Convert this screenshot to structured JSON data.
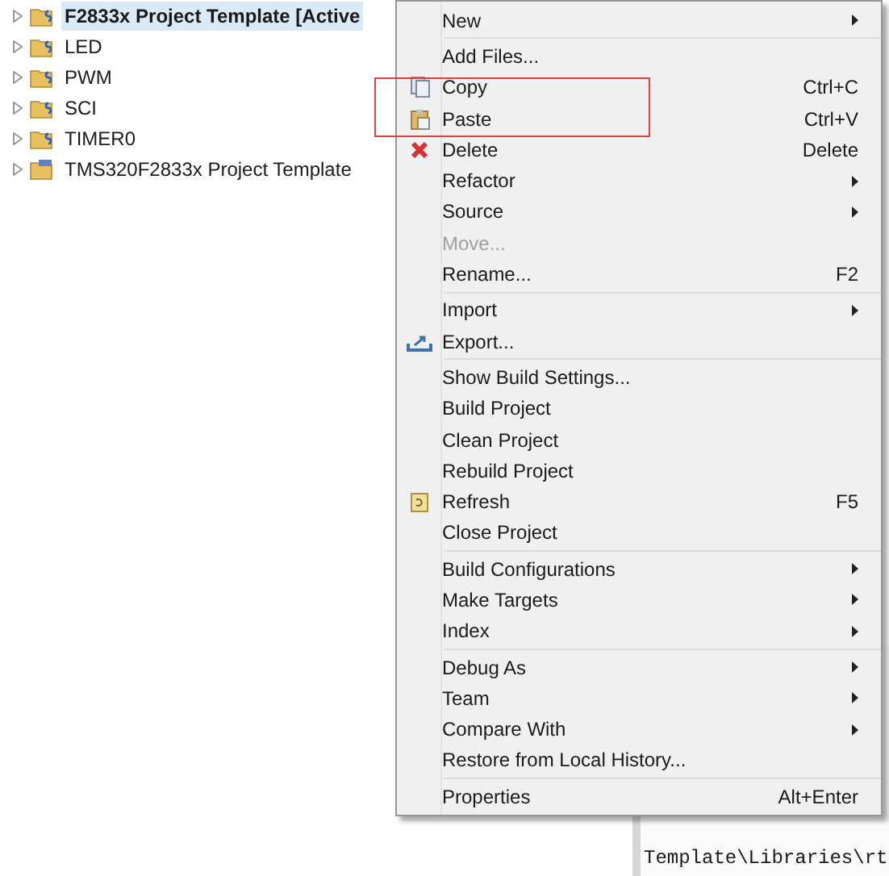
{
  "tree": [
    {
      "label": "F2833x Project Template  [Active",
      "selected": true,
      "kind": "ccs"
    },
    {
      "label": "LED",
      "selected": false,
      "kind": "ccs"
    },
    {
      "label": "PWM",
      "selected": false,
      "kind": "ccs"
    },
    {
      "label": "SCI",
      "selected": false,
      "kind": "ccs"
    },
    {
      "label": "TIMER0",
      "selected": false,
      "kind": "ccs"
    },
    {
      "label": "TMS320F2833x Project Template",
      "selected": false,
      "kind": "project"
    }
  ],
  "context_menu": {
    "groups": [
      [
        {
          "label": "New",
          "submenu": true,
          "disabled": false
        }
      ],
      [
        {
          "label": "Add Files...",
          "submenu": false,
          "disabled": false
        },
        {
          "label": "Copy",
          "shortcut": "Ctrl+C",
          "kind": "copy",
          "submenu": false,
          "disabled": false
        },
        {
          "label": "Paste",
          "shortcut": "Ctrl+V",
          "kind": "paste",
          "submenu": false,
          "disabled": false
        },
        {
          "label": "Delete",
          "shortcut": "Delete",
          "kind": "delete",
          "submenu": false,
          "disabled": false
        },
        {
          "label": "Refactor",
          "submenu": true,
          "disabled": false
        },
        {
          "label": "Source",
          "submenu": true,
          "disabled": false
        },
        {
          "label": "Move...",
          "submenu": false,
          "disabled": true
        },
        {
          "label": "Rename...",
          "shortcut": "F2",
          "submenu": false,
          "disabled": false
        }
      ],
      [
        {
          "label": "Import",
          "submenu": true,
          "disabled": false
        },
        {
          "label": "Export...",
          "kind": "export",
          "submenu": false,
          "disabled": false
        }
      ],
      [
        {
          "label": "Show Build Settings...",
          "submenu": false,
          "disabled": false
        },
        {
          "label": "Build Project",
          "submenu": false,
          "disabled": false
        },
        {
          "label": "Clean Project",
          "submenu": false,
          "disabled": false
        },
        {
          "label": "Rebuild Project",
          "submenu": false,
          "disabled": false
        },
        {
          "label": "Refresh",
          "shortcut": "F5",
          "kind": "refresh",
          "submenu": false,
          "disabled": false
        },
        {
          "label": "Close Project",
          "submenu": false,
          "disabled": false
        }
      ],
      [
        {
          "label": "Build Configurations",
          "submenu": true,
          "disabled": false
        },
        {
          "label": "Make Targets",
          "submenu": true,
          "disabled": false
        },
        {
          "label": "Index",
          "submenu": true,
          "disabled": false
        }
      ],
      [
        {
          "label": "Debug As",
          "submenu": true,
          "disabled": false
        },
        {
          "label": "Team",
          "submenu": true,
          "disabled": false
        },
        {
          "label": "Compare With",
          "submenu": true,
          "disabled": false
        },
        {
          "label": "Restore from Local History...",
          "submenu": false,
          "disabled": false
        }
      ],
      [
        {
          "label": "Properties",
          "shortcut": "Alt+Enter",
          "submenu": false,
          "disabled": false
        }
      ]
    ]
  },
  "console": {
    "line": "Template\\Libraries\\rt"
  }
}
